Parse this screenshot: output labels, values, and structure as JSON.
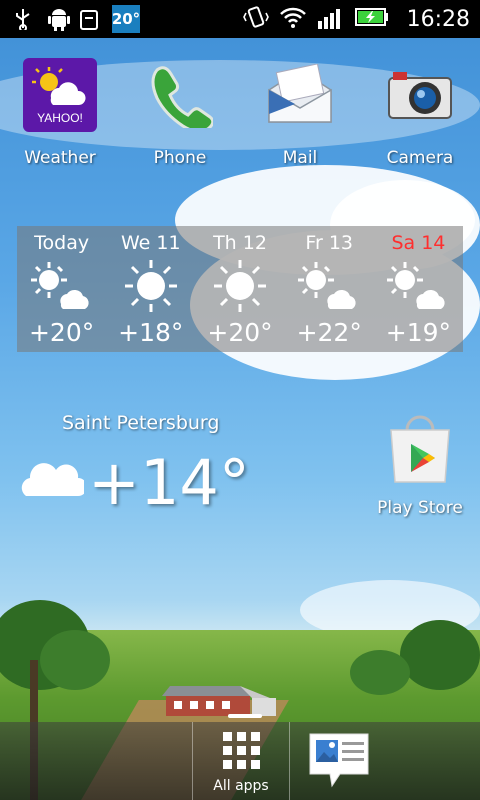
{
  "status_bar": {
    "temperature_badge": "20°",
    "time": "16:28",
    "icons": [
      "usb-icon",
      "android-debug-icon",
      "vibrate-icon",
      "wifi-icon",
      "signal-icon",
      "battery-charging-icon"
    ]
  },
  "apps": [
    {
      "label": "Weather",
      "icon": "yahoo-weather-icon",
      "brand_text": "YAHOO!"
    },
    {
      "label": "Phone",
      "icon": "phone-icon"
    },
    {
      "label": "Mail",
      "icon": "mail-icon"
    },
    {
      "label": "Camera",
      "icon": "camera-icon"
    }
  ],
  "forecast": [
    {
      "day": "Today",
      "temp": "+20°",
      "icon": "sun-cloud-icon"
    },
    {
      "day": "We 11",
      "temp": "+18°",
      "icon": "sun-icon"
    },
    {
      "day": "Th 12",
      "temp": "+20°",
      "icon": "sun-icon"
    },
    {
      "day": "Fr 13",
      "temp": "+22°",
      "icon": "sun-cloud-icon"
    },
    {
      "day": "Sa 14",
      "temp": "+19°",
      "icon": "sun-cloud-icon",
      "weekend": true
    }
  ],
  "current": {
    "city": "Saint Petersburg",
    "temp": "+14°",
    "icon": "cloud-icon"
  },
  "play_store": {
    "label": "Play Store"
  },
  "dock": {
    "all_apps_label": "All apps"
  },
  "colors": {
    "weekend_red": "#ff2e2e",
    "yahoo_purple": "#5c18a8",
    "status_badge_blue": "#1a7fbf",
    "wifi_green": "#3cd23c"
  }
}
